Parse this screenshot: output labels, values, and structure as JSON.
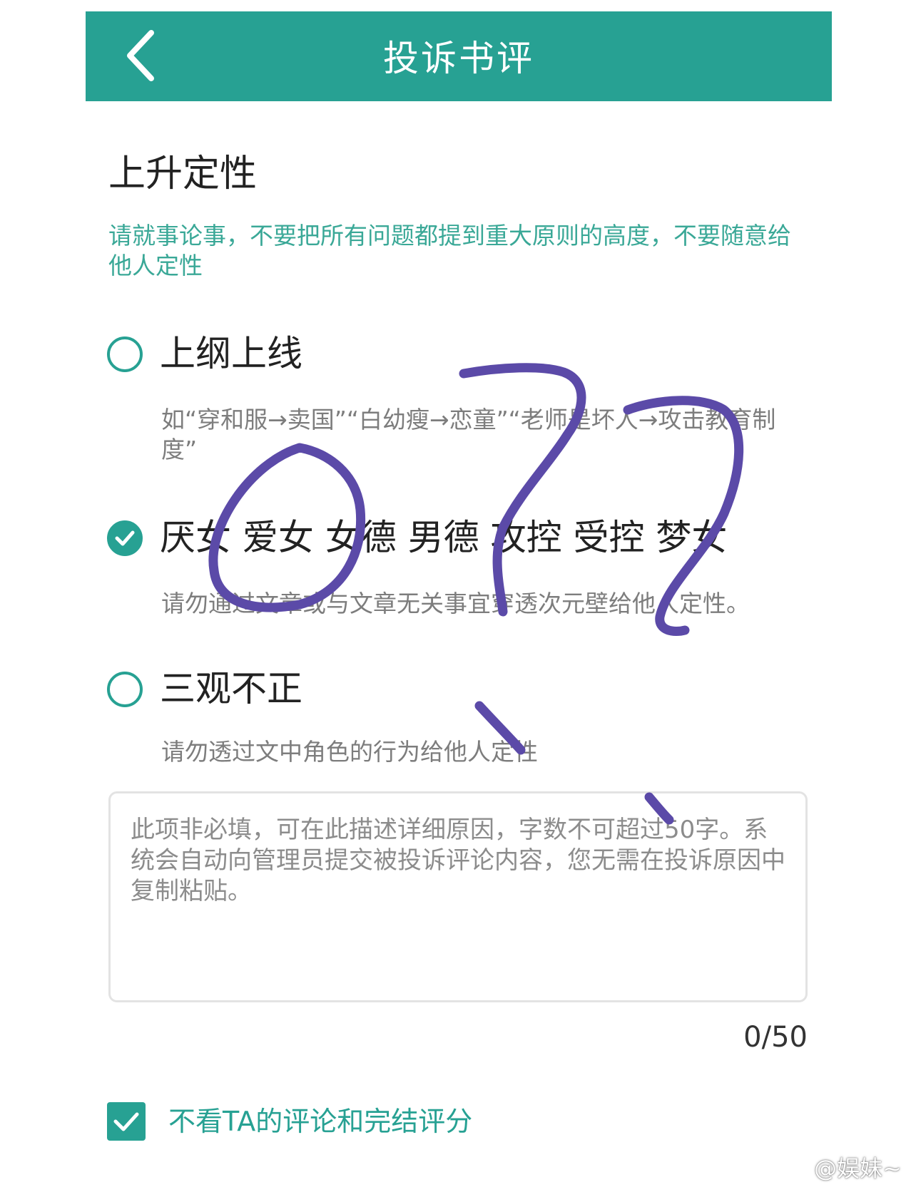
{
  "colors": {
    "accent": "#27a193",
    "description_text": "#3aa897",
    "secondary_text": "#7d7d7d",
    "scribble": "#5b4aa8"
  },
  "header": {
    "back_icon": "chevron-left-icon",
    "title": "投诉书评"
  },
  "section": {
    "title": "上升定性",
    "description": "请就事论事，不要把所有问题都提到重大原则的高度，不要随意给他人定性"
  },
  "options": [
    {
      "label": "上纲上线",
      "description": "如“穿和服→卖国”“白幼瘦→恋童”“老师是坏人→攻击教育制度”",
      "checked": false
    },
    {
      "label": "厌女 爱女 女德 男德 攻控 受控 梦女",
      "description": "请勿通过文章或与文章无关事宜穿透次元壁给他人定性。",
      "checked": true
    },
    {
      "label": "三观不正",
      "description": "请勿透过文中角色的行为给他人定性",
      "checked": false
    }
  ],
  "reason_input": {
    "placeholder": "此项非必填，可在此描述详细原因，字数不可超过50字。系统会自动向管理员提交被投诉评论内容，您无需在投诉原因中复制粘贴。",
    "value": ""
  },
  "counter": "0/50",
  "block_option": {
    "label": "不看TA的评论和完结评分",
    "checked": true
  },
  "watermark": {
    "icon": "weibo-logo-icon",
    "text": "@娱妹~"
  }
}
